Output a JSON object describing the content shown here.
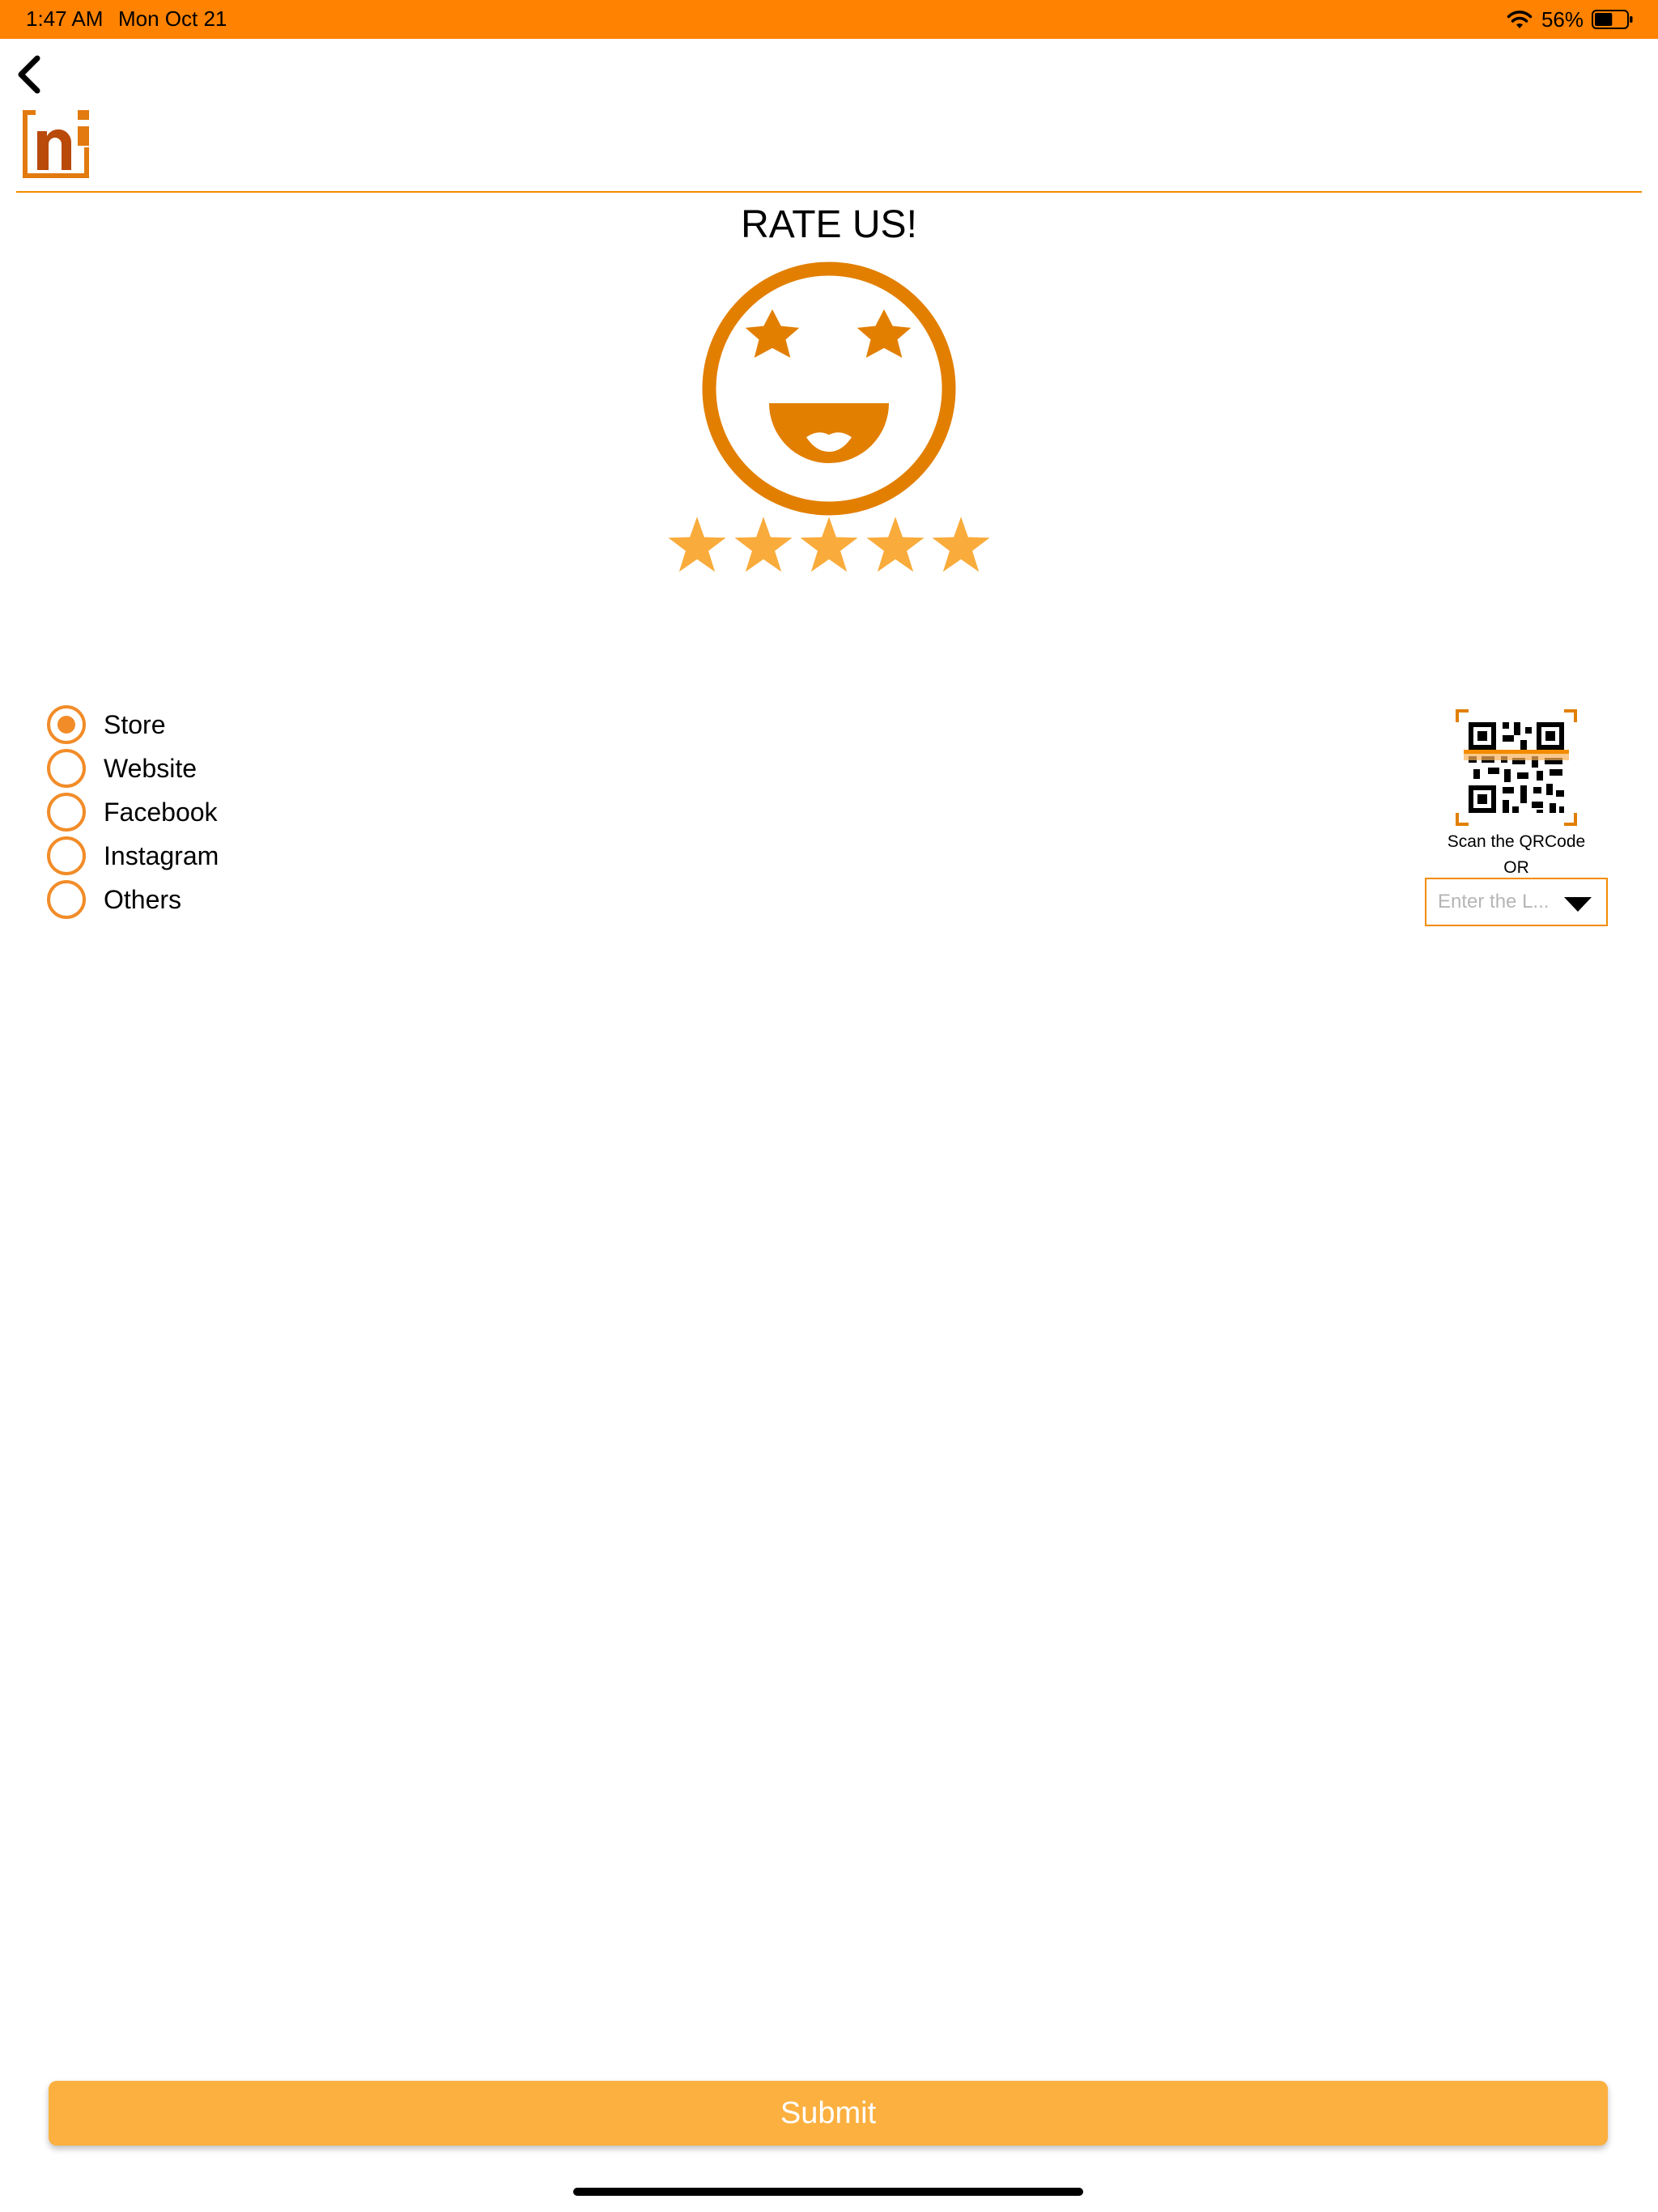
{
  "status_bar": {
    "time": "1:47 AM",
    "date": "Mon Oct 21",
    "battery_percent": "56%",
    "battery_level": 0.56,
    "icons": [
      "wifi-icon",
      "battery-icon"
    ]
  },
  "header": {
    "back_icon": "chevron-left-icon",
    "logo_text": "ni"
  },
  "page": {
    "title": "RATE US!",
    "face_icon": "star-eyes-smiley-icon"
  },
  "rating": {
    "value": 5,
    "max": 5,
    "star_color": "#f9ab3b"
  },
  "sources": {
    "options": [
      {
        "label": "Store",
        "selected": true
      },
      {
        "label": "Website",
        "selected": false
      },
      {
        "label": "Facebook",
        "selected": false
      },
      {
        "label": "Instagram",
        "selected": false
      },
      {
        "label": "Others",
        "selected": false
      }
    ]
  },
  "qr": {
    "icon": "qr-code-scan-icon",
    "caption": "Scan the QRCode",
    "or": "OR"
  },
  "location": {
    "placeholder": "Enter the L...",
    "value": ""
  },
  "submit": {
    "label": "Submit"
  },
  "colors": {
    "accent": "#ff8200",
    "brand": "#e87f00",
    "button": "#fbb040"
  }
}
